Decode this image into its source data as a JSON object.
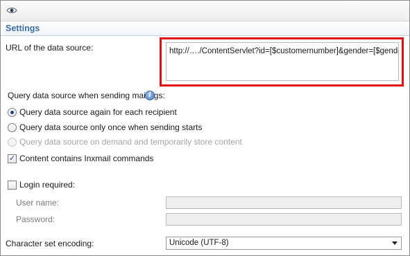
{
  "toolbar": {
    "icon": "eye-icon"
  },
  "section": {
    "title": "Settings"
  },
  "url": {
    "label": "URL of the data source:",
    "value": "http://…./ContentServlet?id=[$customernumber]&gender=[$gender]",
    "highlight_color": "#e01010"
  },
  "query": {
    "label": "Query data source when sending mailings:",
    "help_icon": "help-icon",
    "options": [
      {
        "label": "Query data source again for each recipient",
        "selected": true,
        "enabled": true
      },
      {
        "label": "Query data source only once when sending starts",
        "selected": false,
        "enabled": true
      },
      {
        "label": "Query data source on demand and temporarily store content",
        "selected": false,
        "enabled": false
      }
    ]
  },
  "inxmail": {
    "label": "Content contains Inxmail commands",
    "checked": true
  },
  "login": {
    "label": "Login required:",
    "checked": false,
    "username_label": "User name:",
    "username_value": "",
    "password_label": "Password:",
    "password_value": ""
  },
  "encoding": {
    "label": "Character set encoding:",
    "value": "Unicode (UTF-8)"
  },
  "colors": {
    "section_title": "#3b6ea5",
    "selection": "#1f3f8f"
  }
}
